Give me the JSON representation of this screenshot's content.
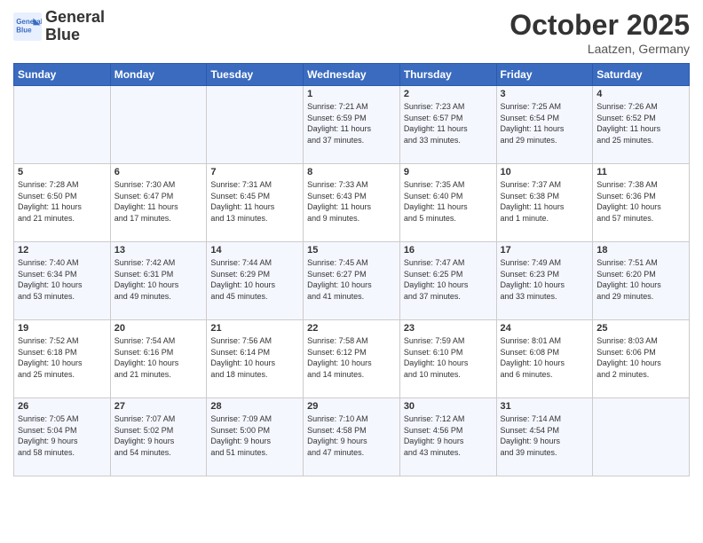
{
  "header": {
    "logo_line1": "General",
    "logo_line2": "Blue",
    "month": "October 2025",
    "location": "Laatzen, Germany"
  },
  "days_of_week": [
    "Sunday",
    "Monday",
    "Tuesday",
    "Wednesday",
    "Thursday",
    "Friday",
    "Saturday"
  ],
  "weeks": [
    [
      {
        "num": "",
        "info": ""
      },
      {
        "num": "",
        "info": ""
      },
      {
        "num": "",
        "info": ""
      },
      {
        "num": "1",
        "info": "Sunrise: 7:21 AM\nSunset: 6:59 PM\nDaylight: 11 hours\nand 37 minutes."
      },
      {
        "num": "2",
        "info": "Sunrise: 7:23 AM\nSunset: 6:57 PM\nDaylight: 11 hours\nand 33 minutes."
      },
      {
        "num": "3",
        "info": "Sunrise: 7:25 AM\nSunset: 6:54 PM\nDaylight: 11 hours\nand 29 minutes."
      },
      {
        "num": "4",
        "info": "Sunrise: 7:26 AM\nSunset: 6:52 PM\nDaylight: 11 hours\nand 25 minutes."
      }
    ],
    [
      {
        "num": "5",
        "info": "Sunrise: 7:28 AM\nSunset: 6:50 PM\nDaylight: 11 hours\nand 21 minutes."
      },
      {
        "num": "6",
        "info": "Sunrise: 7:30 AM\nSunset: 6:47 PM\nDaylight: 11 hours\nand 17 minutes."
      },
      {
        "num": "7",
        "info": "Sunrise: 7:31 AM\nSunset: 6:45 PM\nDaylight: 11 hours\nand 13 minutes."
      },
      {
        "num": "8",
        "info": "Sunrise: 7:33 AM\nSunset: 6:43 PM\nDaylight: 11 hours\nand 9 minutes."
      },
      {
        "num": "9",
        "info": "Sunrise: 7:35 AM\nSunset: 6:40 PM\nDaylight: 11 hours\nand 5 minutes."
      },
      {
        "num": "10",
        "info": "Sunrise: 7:37 AM\nSunset: 6:38 PM\nDaylight: 11 hours\nand 1 minute."
      },
      {
        "num": "11",
        "info": "Sunrise: 7:38 AM\nSunset: 6:36 PM\nDaylight: 10 hours\nand 57 minutes."
      }
    ],
    [
      {
        "num": "12",
        "info": "Sunrise: 7:40 AM\nSunset: 6:34 PM\nDaylight: 10 hours\nand 53 minutes."
      },
      {
        "num": "13",
        "info": "Sunrise: 7:42 AM\nSunset: 6:31 PM\nDaylight: 10 hours\nand 49 minutes."
      },
      {
        "num": "14",
        "info": "Sunrise: 7:44 AM\nSunset: 6:29 PM\nDaylight: 10 hours\nand 45 minutes."
      },
      {
        "num": "15",
        "info": "Sunrise: 7:45 AM\nSunset: 6:27 PM\nDaylight: 10 hours\nand 41 minutes."
      },
      {
        "num": "16",
        "info": "Sunrise: 7:47 AM\nSunset: 6:25 PM\nDaylight: 10 hours\nand 37 minutes."
      },
      {
        "num": "17",
        "info": "Sunrise: 7:49 AM\nSunset: 6:23 PM\nDaylight: 10 hours\nand 33 minutes."
      },
      {
        "num": "18",
        "info": "Sunrise: 7:51 AM\nSunset: 6:20 PM\nDaylight: 10 hours\nand 29 minutes."
      }
    ],
    [
      {
        "num": "19",
        "info": "Sunrise: 7:52 AM\nSunset: 6:18 PM\nDaylight: 10 hours\nand 25 minutes."
      },
      {
        "num": "20",
        "info": "Sunrise: 7:54 AM\nSunset: 6:16 PM\nDaylight: 10 hours\nand 21 minutes."
      },
      {
        "num": "21",
        "info": "Sunrise: 7:56 AM\nSunset: 6:14 PM\nDaylight: 10 hours\nand 18 minutes."
      },
      {
        "num": "22",
        "info": "Sunrise: 7:58 AM\nSunset: 6:12 PM\nDaylight: 10 hours\nand 14 minutes."
      },
      {
        "num": "23",
        "info": "Sunrise: 7:59 AM\nSunset: 6:10 PM\nDaylight: 10 hours\nand 10 minutes."
      },
      {
        "num": "24",
        "info": "Sunrise: 8:01 AM\nSunset: 6:08 PM\nDaylight: 10 hours\nand 6 minutes."
      },
      {
        "num": "25",
        "info": "Sunrise: 8:03 AM\nSunset: 6:06 PM\nDaylight: 10 hours\nand 2 minutes."
      }
    ],
    [
      {
        "num": "26",
        "info": "Sunrise: 7:05 AM\nSunset: 5:04 PM\nDaylight: 9 hours\nand 58 minutes."
      },
      {
        "num": "27",
        "info": "Sunrise: 7:07 AM\nSunset: 5:02 PM\nDaylight: 9 hours\nand 54 minutes."
      },
      {
        "num": "28",
        "info": "Sunrise: 7:09 AM\nSunset: 5:00 PM\nDaylight: 9 hours\nand 51 minutes."
      },
      {
        "num": "29",
        "info": "Sunrise: 7:10 AM\nSunset: 4:58 PM\nDaylight: 9 hours\nand 47 minutes."
      },
      {
        "num": "30",
        "info": "Sunrise: 7:12 AM\nSunset: 4:56 PM\nDaylight: 9 hours\nand 43 minutes."
      },
      {
        "num": "31",
        "info": "Sunrise: 7:14 AM\nSunset: 4:54 PM\nDaylight: 9 hours\nand 39 minutes."
      },
      {
        "num": "",
        "info": ""
      }
    ]
  ]
}
